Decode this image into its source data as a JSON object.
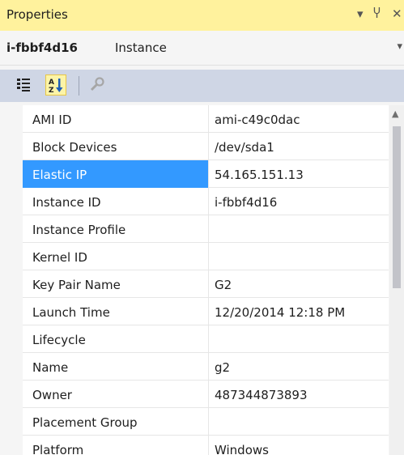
{
  "window": {
    "title": "Properties",
    "dropdown_glyph": "▾",
    "pin_glyph": "Ⴤ",
    "close_glyph": "✕"
  },
  "object": {
    "name": "i-fbbf4d16",
    "type": "Instance"
  },
  "toolbar": {
    "icons": [
      "categorized-icon",
      "alphabetical-icon",
      "property-pages-icon"
    ],
    "active": "alphabetical-icon"
  },
  "properties": [
    {
      "name": "AMI ID",
      "value": "ami-c49c0dac"
    },
    {
      "name": "Block Devices",
      "value": "/dev/sda1"
    },
    {
      "name": "Elastic IP",
      "value": "54.165.151.13"
    },
    {
      "name": "Instance ID",
      "value": "i-fbbf4d16"
    },
    {
      "name": "Instance Profile",
      "value": ""
    },
    {
      "name": "Kernel ID",
      "value": ""
    },
    {
      "name": "Key Pair Name",
      "value": "G2"
    },
    {
      "name": "Launch Time",
      "value": "12/20/2014 12:18 PM"
    },
    {
      "name": "Lifecycle",
      "value": ""
    },
    {
      "name": "Name",
      "value": "g2"
    },
    {
      "name": "Owner",
      "value": "487344873893"
    },
    {
      "name": "Placement Group",
      "value": ""
    },
    {
      "name": "Platform",
      "value": "Windows"
    }
  ],
  "selected_property": "Elastic IP",
  "colors": {
    "titlebar": "#fff29d",
    "toolbar": "#cfd6e5",
    "selection": "#3399ff"
  }
}
